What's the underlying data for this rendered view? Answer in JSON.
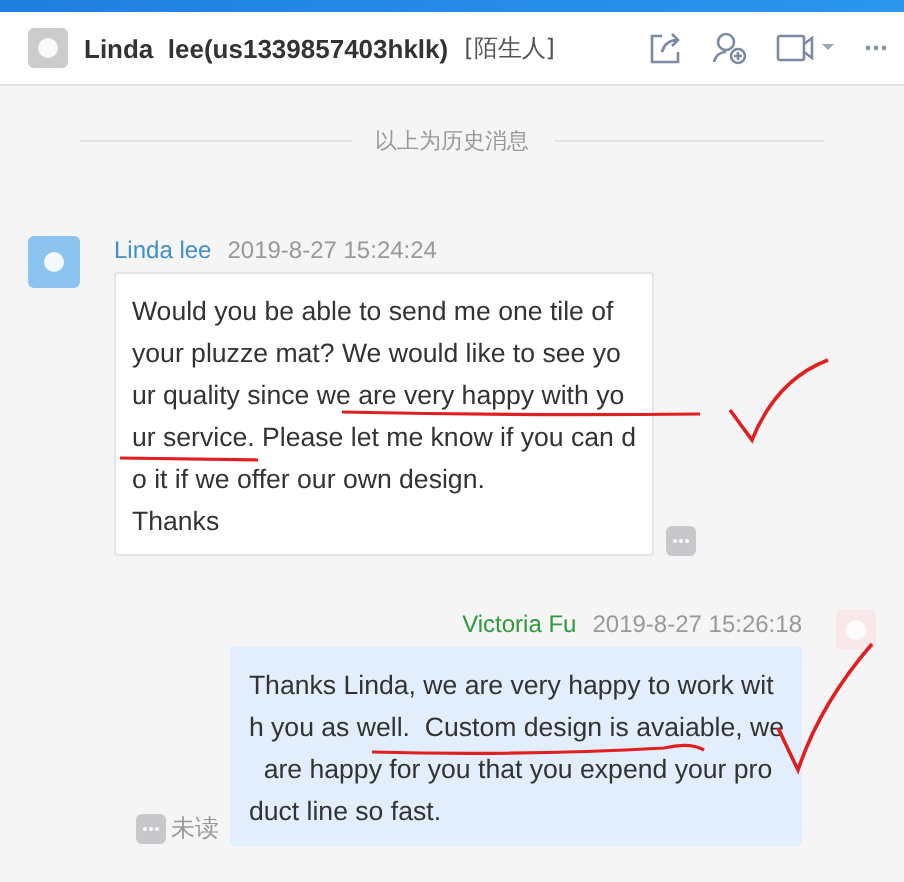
{
  "header": {
    "name": "Linda  lee(us1339857403hklk)",
    "tag": "[陌生人]"
  },
  "history_divider": "以上为历史消息",
  "messages": [
    {
      "kind": "incoming",
      "sender": "Linda lee",
      "time": "2019-8-27 15:24:24",
      "lines": [
        "Would you be able to send me one tile of",
        "your pluzze mat? We would like to see yo",
        "ur quality since we are very happy with yo",
        "ur service. Please let me know if you can d",
        "o it if we offer our own design.",
        "Thanks"
      ]
    },
    {
      "kind": "outgoing",
      "sender": "Victoria Fu",
      "time": "2019-8-27 15:26:18",
      "lines": [
        "Thanks Linda, we are very happy to work wit",
        "h you as well.  Custom design is avaiable, we",
        "  are happy for you that you expend your pro",
        "duct line so fast."
      ],
      "status": "未读"
    }
  ]
}
